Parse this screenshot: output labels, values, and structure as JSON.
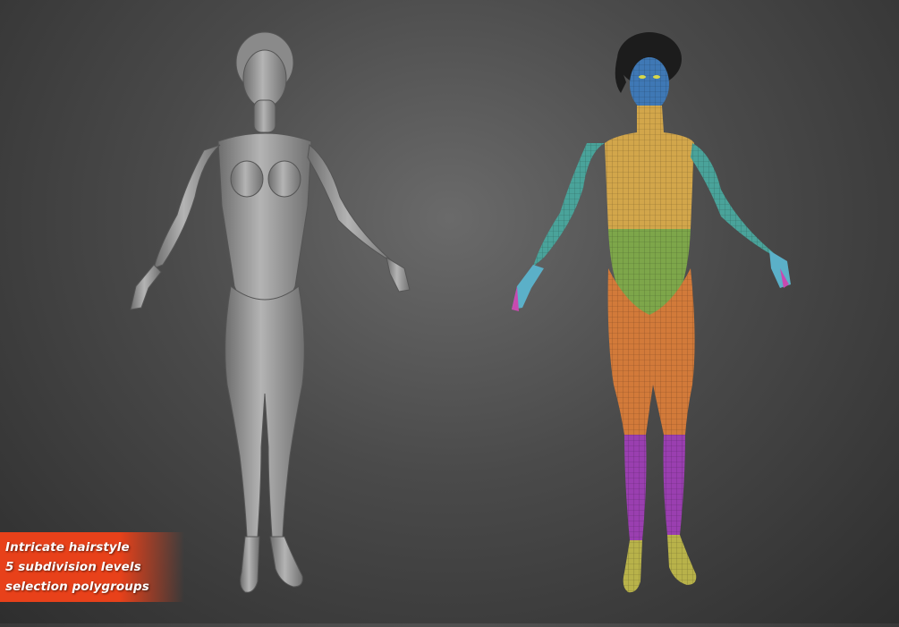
{
  "caption": {
    "lines": [
      "Intricate hairstyle",
      "5 subdivision levels",
      "selection polygroups"
    ]
  },
  "figures": {
    "left": {
      "icon": "sculpt-figure-grey"
    },
    "right": {
      "icon": "sculpt-figure-polygroups"
    }
  },
  "colors": {
    "clay": "#9a9a9a",
    "face": "#3f78b5",
    "torso": "#d2a64b",
    "belly": "#7da64a",
    "arms": "#4aa39a",
    "legs": "#d27a3a",
    "calves": "#9a3fb0",
    "feet": "#b8b24a",
    "caption_bg": "#e8411a"
  }
}
